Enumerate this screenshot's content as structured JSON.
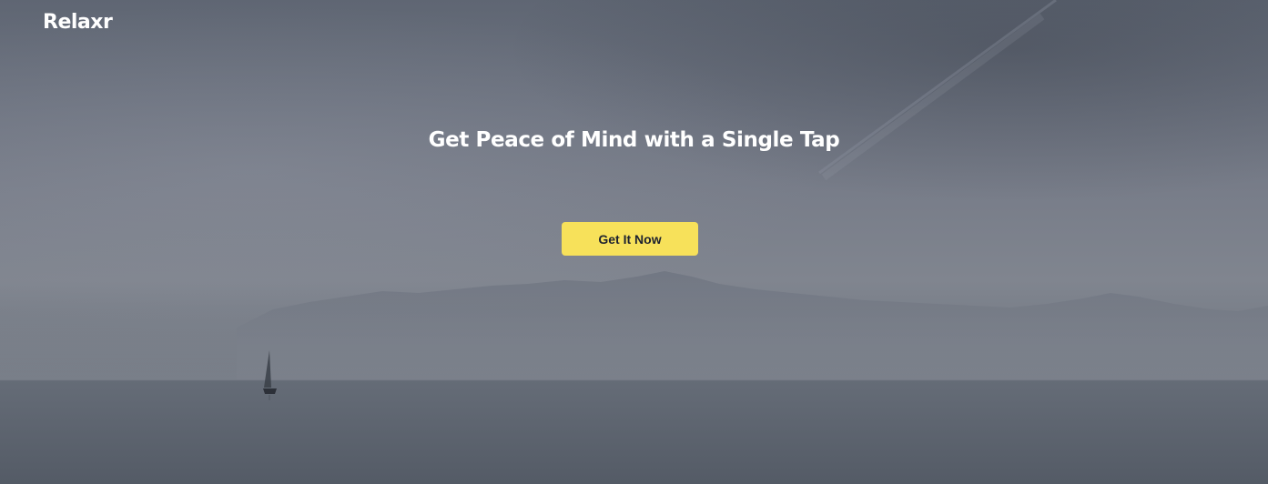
{
  "brand": {
    "name": "Relaxr"
  },
  "hero": {
    "headline": "Get Peace of Mind with a Single Tap",
    "cta_label": "Get It Now"
  },
  "colors": {
    "cta_background": "#f7e15a",
    "cta_text": "#1d2230",
    "text": "#ffffff"
  }
}
